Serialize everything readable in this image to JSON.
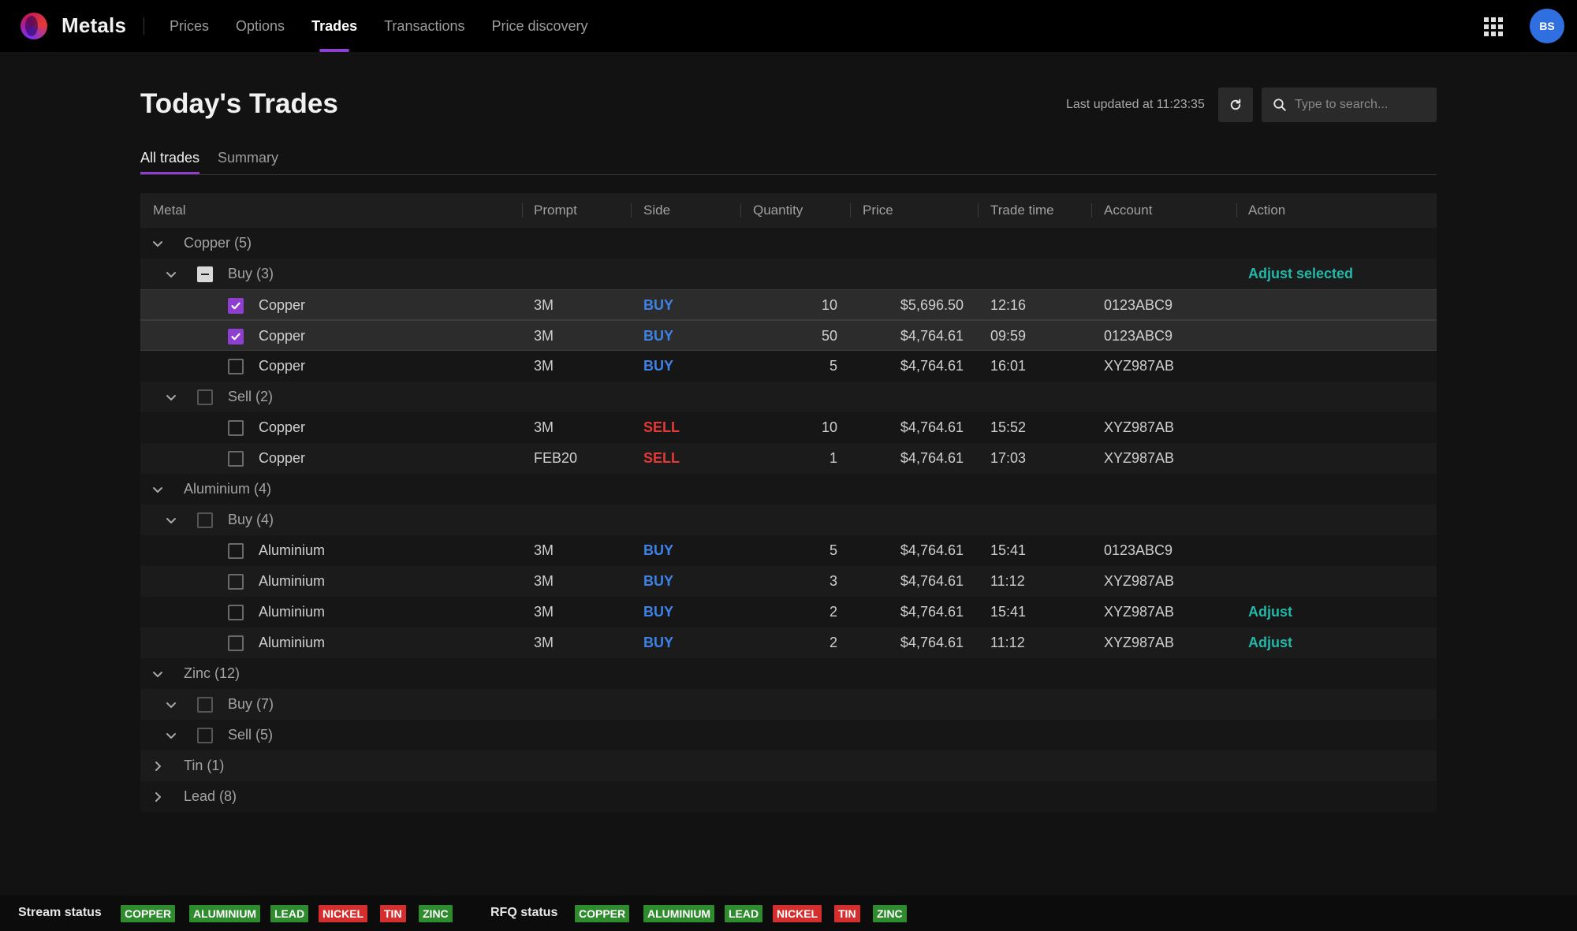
{
  "app": {
    "title": "Metals",
    "avatar_initials": "BS"
  },
  "nav": [
    {
      "label": "Prices",
      "active": false
    },
    {
      "label": "Options",
      "active": false
    },
    {
      "label": "Trades",
      "active": true
    },
    {
      "label": "Transactions",
      "active": false
    },
    {
      "label": "Price discovery",
      "active": false
    }
  ],
  "page": {
    "title": "Today's Trades",
    "last_updated": "Last updated at 11:23:35",
    "search_placeholder": "Type to search..."
  },
  "tabs": [
    {
      "label": "All trades",
      "active": true
    },
    {
      "label": "Summary",
      "active": false
    }
  ],
  "columns": [
    "Metal",
    "Prompt",
    "Side",
    "Quantity",
    "Price",
    "Trade time",
    "Account",
    "Action"
  ],
  "rows": [
    {
      "type": "group",
      "level": 0,
      "expanded": true,
      "label": "Copper (5)"
    },
    {
      "type": "subgroup",
      "level": 1,
      "expanded": true,
      "check": "indeterminate",
      "label": "Buy (3)",
      "action": "Adjust selected"
    },
    {
      "type": "leaf",
      "checked": true,
      "metal": "Copper",
      "prompt": "3M",
      "side": "BUY",
      "quantity": "10",
      "price": "$5,696.50",
      "time": "12:16",
      "account": "0123ABC9",
      "action": ""
    },
    {
      "type": "leaf",
      "checked": true,
      "metal": "Copper",
      "prompt": "3M",
      "side": "BUY",
      "quantity": "50",
      "price": "$4,764.61",
      "time": "09:59",
      "account": "0123ABC9",
      "action": ""
    },
    {
      "type": "leaf",
      "checked": false,
      "metal": "Copper",
      "prompt": "3M",
      "side": "BUY",
      "quantity": "5",
      "price": "$4,764.61",
      "time": "16:01",
      "account": "XYZ987AB",
      "action": ""
    },
    {
      "type": "subgroup",
      "level": 1,
      "expanded": true,
      "check": "none",
      "label": "Sell (2)",
      "action": ""
    },
    {
      "type": "leaf",
      "checked": false,
      "metal": "Copper",
      "prompt": "3M",
      "side": "SELL",
      "quantity": "10",
      "price": "$4,764.61",
      "time": "15:52",
      "account": "XYZ987AB",
      "action": ""
    },
    {
      "type": "leaf",
      "checked": false,
      "metal": "Copper",
      "prompt": "FEB20",
      "side": "SELL",
      "quantity": "1",
      "price": "$4,764.61",
      "time": "17:03",
      "account": "XYZ987AB",
      "action": ""
    },
    {
      "type": "group",
      "level": 0,
      "expanded": true,
      "label": "Aluminium (4)"
    },
    {
      "type": "subgroup",
      "level": 1,
      "expanded": true,
      "check": "none",
      "label": "Buy (4)",
      "action": ""
    },
    {
      "type": "leaf",
      "checked": false,
      "metal": "Aluminium",
      "prompt": "3M",
      "side": "BUY",
      "quantity": "5",
      "price": "$4,764.61",
      "time": "15:41",
      "account": "0123ABC9",
      "action": ""
    },
    {
      "type": "leaf",
      "checked": false,
      "metal": "Aluminium",
      "prompt": "3M",
      "side": "BUY",
      "quantity": "3",
      "price": "$4,764.61",
      "time": "11:12",
      "account": "XYZ987AB",
      "action": ""
    },
    {
      "type": "leaf",
      "checked": false,
      "metal": "Aluminium",
      "prompt": "3M",
      "side": "BUY",
      "quantity": "2",
      "price": "$4,764.61",
      "time": "15:41",
      "account": "XYZ987AB",
      "action": "Adjust"
    },
    {
      "type": "leaf",
      "checked": false,
      "metal": "Aluminium",
      "prompt": "3M",
      "side": "BUY",
      "quantity": "2",
      "price": "$4,764.61",
      "time": "11:12",
      "account": "XYZ987AB",
      "action": "Adjust"
    },
    {
      "type": "group",
      "level": 0,
      "expanded": true,
      "label": "Zinc (12)"
    },
    {
      "type": "subgroup",
      "level": 1,
      "expanded": true,
      "check": "none",
      "label": "Buy (7)",
      "action": ""
    },
    {
      "type": "subgroup",
      "level": 1,
      "expanded": true,
      "check": "none",
      "label": "Sell (5)",
      "action": ""
    },
    {
      "type": "group",
      "level": 0,
      "expanded": false,
      "label": "Tin (1)"
    },
    {
      "type": "group",
      "level": 0,
      "expanded": false,
      "label": "Lead (8)"
    }
  ],
  "status": {
    "stream_label": "Stream status",
    "stream": [
      {
        "name": "COPPER",
        "ok": true
      },
      {
        "name": "ALUMINIUM",
        "ok": true
      },
      {
        "name": "LEAD",
        "ok": true
      },
      {
        "name": "NICKEL",
        "ok": false
      },
      {
        "name": "TIN",
        "ok": false
      },
      {
        "name": "ZINC",
        "ok": true
      }
    ],
    "rfq_label": "RFQ status",
    "rfq": [
      {
        "name": "COPPER",
        "ok": true
      },
      {
        "name": "ALUMINIUM",
        "ok": true
      },
      {
        "name": "LEAD",
        "ok": true
      },
      {
        "name": "NICKEL",
        "ok": false
      },
      {
        "name": "TIN",
        "ok": false
      },
      {
        "name": "ZINC",
        "ok": true
      }
    ]
  },
  "colors": {
    "accent": "#8e3fd0",
    "buy": "#3e82e8",
    "sell": "#e53935",
    "action": "#22b8a8",
    "status_ok": "#2e8b2e",
    "status_error": "#d32f2f"
  },
  "icons": {
    "logo": "metals-logo-icon",
    "apps": "grid-apps-icon",
    "refresh": "refresh-icon",
    "search": "search-icon",
    "expand": "chevron-down-icon",
    "collapse": "chevron-right-icon"
  }
}
